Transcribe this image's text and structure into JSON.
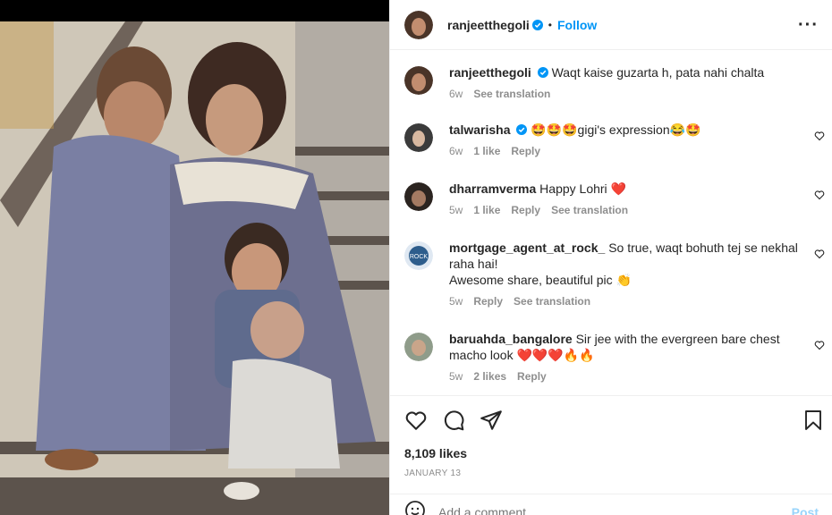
{
  "post": {
    "username": "ranjeetthegoli",
    "follow_label": "Follow",
    "caption": {
      "username": "ranjeetthegoli",
      "text": "Waqt kaise guzarta h, pata nahi chalta",
      "time": "6w",
      "see_translation": "See translation"
    }
  },
  "comments": [
    {
      "username": "talwarisha",
      "text": "🤩🤩🤩gigi's expression😂🤩",
      "time": "6w",
      "likes": "1 like",
      "reply": "Reply",
      "see_translation": ""
    },
    {
      "username": "dharramverma",
      "text": "Happy Lohri ❤️",
      "time": "5w",
      "likes": "1 like",
      "reply": "Reply",
      "see_translation": "See translation"
    },
    {
      "username": "mortgage_agent_at_rock_",
      "text": "So true, waqt bohuth tej se nekhal raha hai!",
      "text2": "Awesome share, beautiful pic 👏",
      "time": "5w",
      "likes": "",
      "reply": "Reply",
      "see_translation": "See translation"
    },
    {
      "username": "baruahda_bangalore",
      "text": "Sir jee with the evergreen bare chest macho look ❤️❤️❤️🔥🔥",
      "time": "5w",
      "likes": "2 likes",
      "reply": "Reply",
      "see_translation": ""
    }
  ],
  "stats": {
    "likes": "8,109 likes",
    "date": "JANUARY 13"
  },
  "add_comment": {
    "placeholder": "Add a comment...",
    "post_label": "Post"
  },
  "icons": {
    "more": "more-options-icon",
    "like": "heart-icon",
    "comment": "comment-icon",
    "share": "share-icon",
    "save": "bookmark-icon",
    "emoji": "emoji-icon"
  },
  "colors": {
    "accent": "#0095f6",
    "muted": "#8e8e8e",
    "text": "#262626"
  }
}
